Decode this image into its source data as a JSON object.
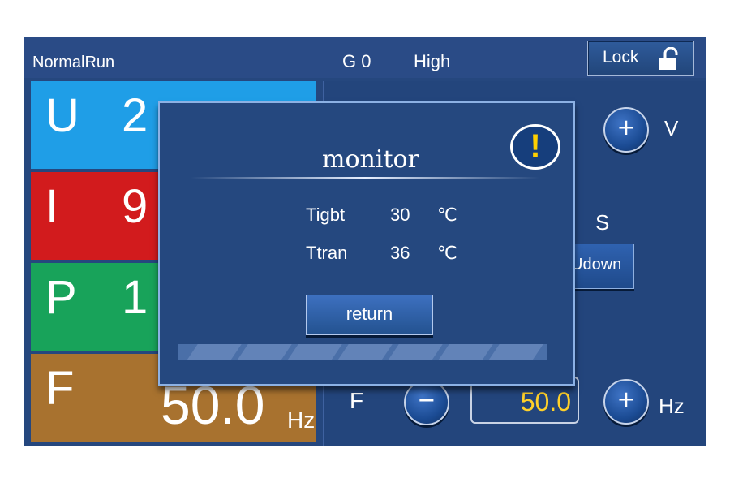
{
  "topbar": {
    "mode": "NormalRun",
    "gear": "G 0",
    "level": "High",
    "lock_label": "Lock"
  },
  "tiles": [
    {
      "letter": "U",
      "value": "2"
    },
    {
      "letter": "I",
      "value": "9"
    },
    {
      "letter": "P",
      "value": "1"
    },
    {
      "letter": "F",
      "value": "50.0",
      "unit": "Hz"
    }
  ],
  "controls": {
    "plus": "+",
    "minus": "−",
    "voltage_unit": "V",
    "time_unit": "S",
    "frequency_label": "F",
    "frequency_value": "50.0",
    "frequency_unit": "Hz",
    "udown_label": "Udown"
  },
  "modal": {
    "title": "monitor",
    "warning_symbol": "!",
    "rows": [
      {
        "label": "Tigbt",
        "value": "30",
        "unit": "℃"
      },
      {
        "label": "Ttran",
        "value": "36",
        "unit": "℃"
      }
    ],
    "return_label": "return"
  },
  "colors": {
    "screen_background": "#25477e",
    "u_tile": "#1f9ee7",
    "i_tile": "#d21b1d",
    "p_tile": "#18a35a",
    "f_tile": "#a8722f",
    "value_text": "#ffd12a"
  },
  "icons": {
    "lock": "unlocked-padlock-icon",
    "warning": "warning-icon"
  }
}
